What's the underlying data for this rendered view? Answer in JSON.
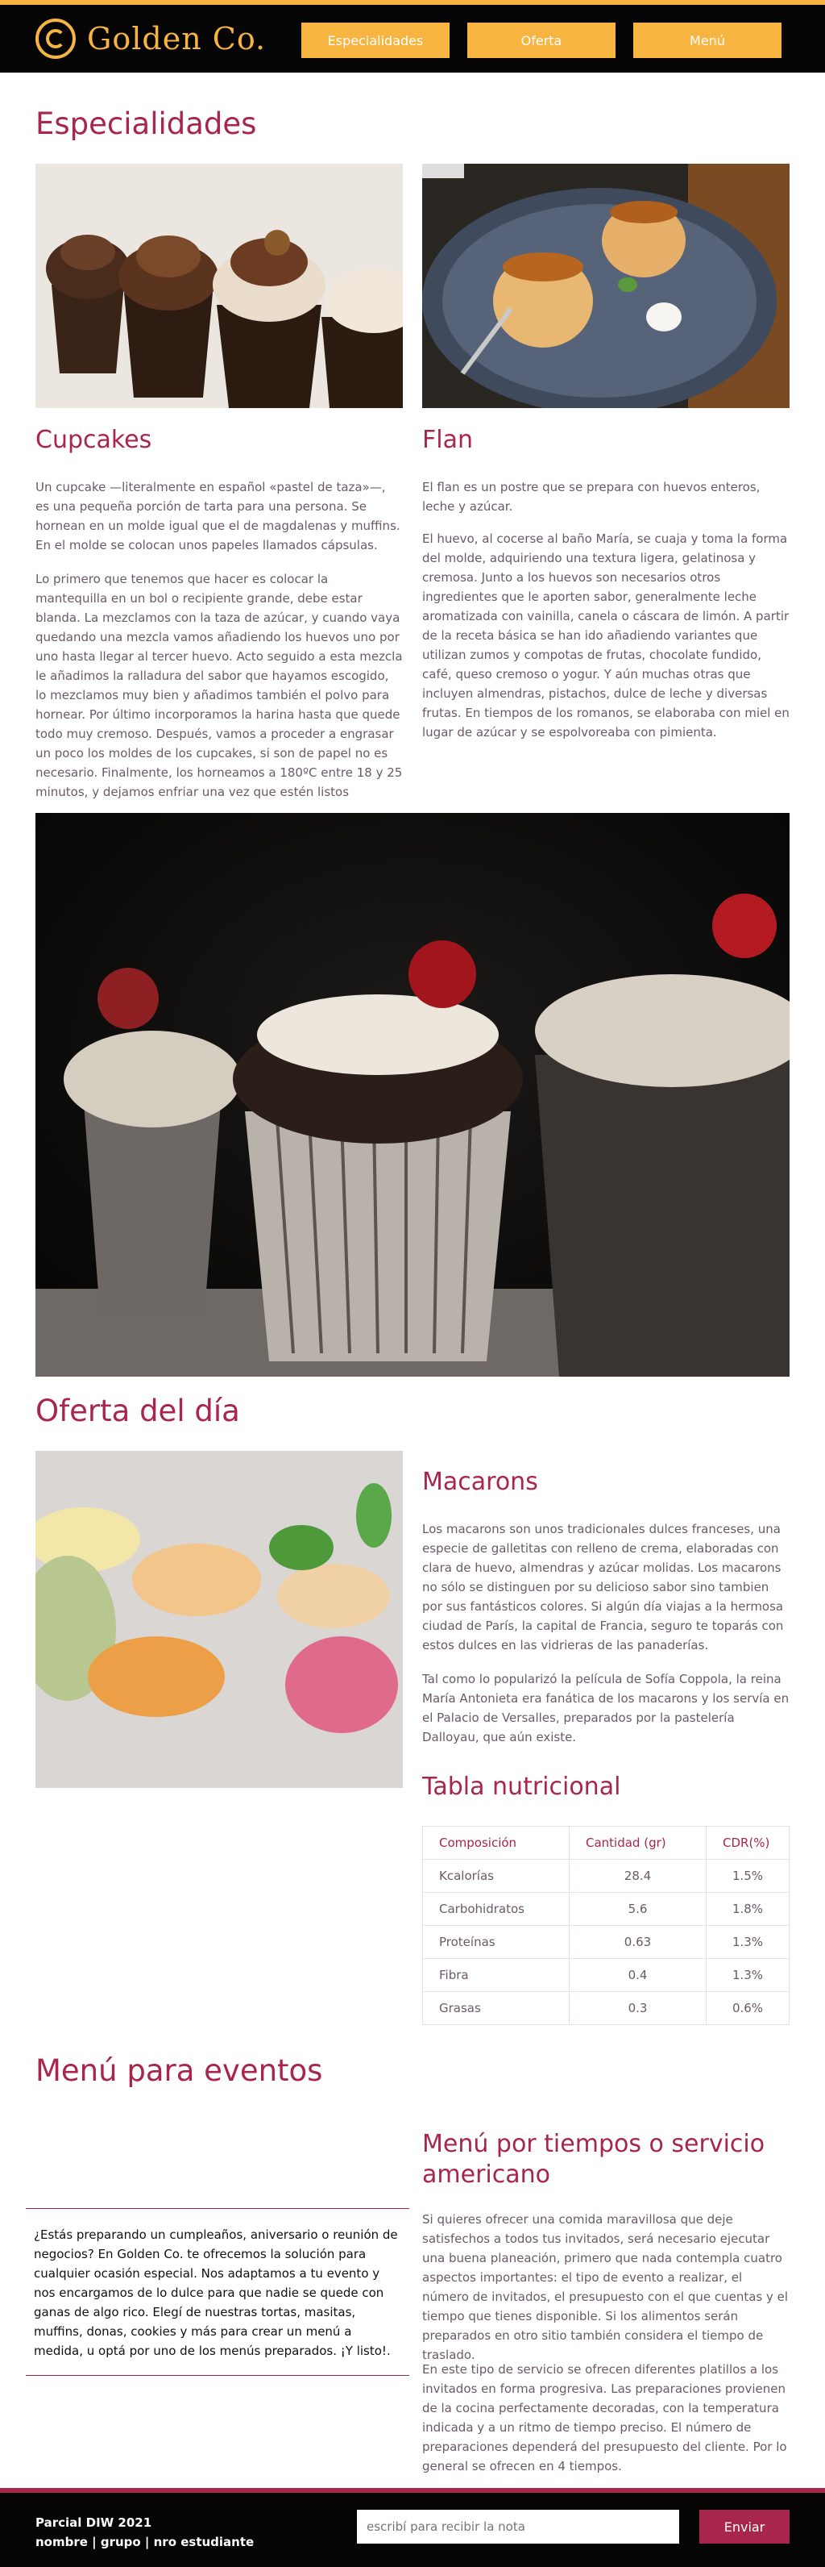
{
  "header": {
    "brand": "Golden Co.",
    "nav": [
      "Especialidades",
      "Oferta",
      "Menú"
    ]
  },
  "specialties": {
    "title": "Especialidades",
    "cupcakes": {
      "title": "Cupcakes",
      "p1": "Un cupcake —literalmente en español «pastel de taza»—, es una pequeña porción de tarta para una persona. Se hornean en un molde igual que el de magdalenas y muffins. En el molde se colocan unos papeles llamados cápsulas.",
      "p2": "Lo primero que tenemos que hacer es colocar la mantequilla en un bol o recipiente grande, debe estar blanda. La mezclamos con la taza de azúcar, y cuando vaya quedando una mezcla vamos añadiendo los huevos uno por uno hasta llegar al tercer huevo. Acto seguido a esta mezcla le añadimos la ralladura del sabor que hayamos escogido, lo mezclamos muy bien y añadimos también el polvo para hornear. Por último incorporamos la harina hasta que quede todo muy cremoso. Después, vamos a proceder a engrasar un poco los moldes de los cupcakes, si son de papel no es necesario. Finalmente, los horneamos a 180ºC entre 18 y 25 minutos, y dejamos enfriar una vez que estén listos"
    },
    "flan": {
      "title": "Flan",
      "p1": "El flan es un postre que se prepara con huevos enteros, leche y azúcar.",
      "p2": "El huevo, al cocerse al baño María, se cuaja y toma la forma del molde, adquiriendo una textura ligera, gelatinosa y cremosa. Junto a los huevos son necesarios otros ingredientes que le aporten sabor, generalmente leche aromatizada con vainilla, canela o cáscara de limón. A partir de la receta básica se han ido añadiendo variantes que utilizan zumos y compotas de frutas, chocolate fundido, café, queso cremoso o yogur. Y aún muchas otras que incluyen almendras, pistachos, dulce de leche y diversas frutas. En tiempos de los romanos, se elaboraba con miel en lugar de azúcar y se espolvoreaba con pimienta."
    }
  },
  "offer": {
    "title": "Oferta del día",
    "macarons": {
      "title": "Macarons",
      "p1": "Los macarons son unos tradicionales dulces franceses, una especie de galletitas con relleno de crema, elaboradas con clara de huevo, almendras y azúcar molidas. Los macarons no sólo se distinguen por su delicioso sabor sino tambien por sus fantásticos colores. Si algún día viajas a la hermosa ciudad de París, la capital de Francia, seguro te toparás con estos dulces en las vidrieras de las panaderías.",
      "p2": "Tal como lo popularizó la película de Sofía Coppola, la reina María Antonieta era fanática de los macarons y los servía en el Palacio de Versalles, preparados por la pastelería Dalloyau, que aún existe."
    },
    "table": {
      "title": "Tabla nutricional",
      "headers": [
        "Composición",
        "Cantidad (gr)",
        "CDR(%)"
      ],
      "rows": [
        [
          "Kcalorías",
          "28.4",
          "1.5%"
        ],
        [
          "Carbohidratos",
          "5.6",
          "1.8%"
        ],
        [
          "Proteínas",
          "0.63",
          "1.3%"
        ],
        [
          "Fibra",
          "0.4",
          "1.3%"
        ],
        [
          "Grasas",
          "0.3",
          "0.6%"
        ]
      ]
    }
  },
  "menu": {
    "title": "Menú para eventos",
    "quote": "¿Estás preparando un cumpleaños, aniversario o reunión de negocios? En Golden Co. te ofrecemos la solución para cualquier ocasión especial. Nos adaptamos a tu evento y nos encargamos de lo dulce para que nadie se quede con ganas de algo rico. Elegí de nuestras tortas, masitas, muffins, donas, cookies y más para crear un menú a medida, u optá por uno de los menús preparados. ¡Y listo!.",
    "sub_title": "Menú por tiempos o servicio americano",
    "p1": "Si quieres ofrecer una comida maravillosa que deje satisfechos a todos tus invitados, será necesario ejecutar una buena planeación, primero que nada contempla cuatro aspectos importantes: el tipo de evento a realizar, el número de invitados, el presupuesto con el que cuentas y el tiempo que tienes disponible. Si los alimentos serán preparados en otro sitio también considera el tiempo de traslado.",
    "p2": "En este tipo de servicio se ofrecen diferentes platillos a los invitados en forma progresiva. Las preparaciones provienen de la cocina perfectamente decoradas, con la temperatura indicada y a un ritmo de tiempo preciso. El número de preparaciones dependerá del presupuesto del cliente. Por lo general se ofrecen en 4 tiempos."
  },
  "footer": {
    "line1": "Parcial DIW 2021",
    "line2": "nombre | grupo | nro estudiante",
    "input_placeholder": "escribí para recibir la nota",
    "button": "Enviar"
  },
  "colors": {
    "gold": "#f7b440",
    "wine": "#a8264b",
    "black": "#050505"
  }
}
